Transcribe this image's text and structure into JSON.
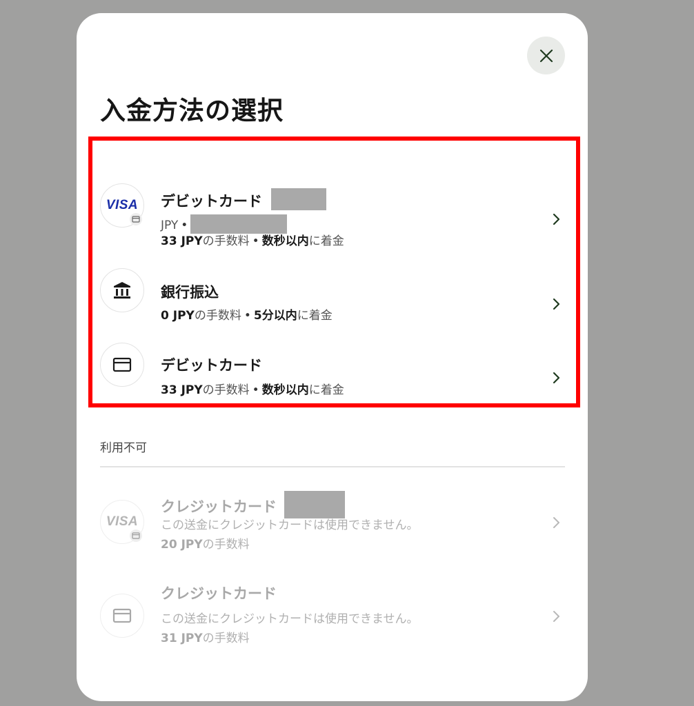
{
  "modal": {
    "title": "入金方法の選択"
  },
  "available_methods": [
    {
      "title": "デビットカード",
      "brand": "VISA",
      "currency": "JPY",
      "fee": "33 JPY",
      "fee_suffix": "の手数料",
      "time": "数秒以内",
      "time_suffix": "に着金"
    },
    {
      "title": "銀行振込",
      "fee": "0 JPY",
      "fee_suffix": "の手数料",
      "time": "5分以内",
      "time_suffix": "に着金"
    },
    {
      "title": "デビットカード",
      "fee": "33 JPY",
      "fee_suffix": "の手数料",
      "time": "数秒以内",
      "time_suffix": "に着金"
    }
  ],
  "unavailable": {
    "label": "利用不可",
    "methods": [
      {
        "title": "クレジットカード",
        "brand": "VISA",
        "message": "この送金にクレジットカードは使用できません。",
        "fee": "20 JPY",
        "fee_suffix": "の手数料"
      },
      {
        "title": "クレジットカード",
        "message": "この送金にクレジットカードは使用できません。",
        "fee": "31 JPY",
        "fee_suffix": "の手数料"
      }
    ]
  },
  "separator": "•",
  "icons": {
    "close": "close-icon",
    "bank": "bank-icon",
    "card": "card-icon",
    "chevron": "chevron-right-icon"
  },
  "colors": {
    "highlight_border": "#ff0000",
    "close_bg": "#e9ebe8",
    "visa_blue": "#1a2ea8"
  }
}
